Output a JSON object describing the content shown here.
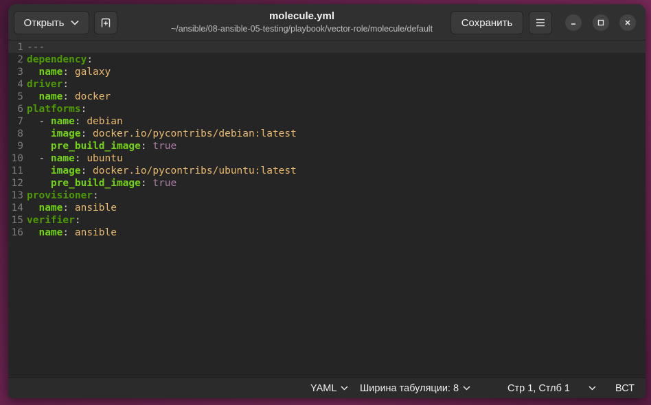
{
  "header": {
    "open_label": "Открыть",
    "save_label": "Сохранить",
    "title": "molecule.yml",
    "subtitle": "~/ansible/08-ansible-05-testing/playbook/vector-role/molecule/default"
  },
  "editor": {
    "lines": [
      {
        "n": "1",
        "parts": [
          {
            "t": "---",
            "c": "dash"
          }
        ]
      },
      {
        "n": "2",
        "parts": [
          {
            "t": "dependency",
            "c": "key"
          },
          {
            "t": ":",
            "c": "p"
          }
        ]
      },
      {
        "n": "3",
        "parts": [
          {
            "t": "  ",
            "c": "p"
          },
          {
            "t": "name",
            "c": "subkey"
          },
          {
            "t": ": ",
            "c": "p"
          },
          {
            "t": "galaxy",
            "c": "v"
          }
        ]
      },
      {
        "n": "4",
        "parts": [
          {
            "t": "driver",
            "c": "key"
          },
          {
            "t": ":",
            "c": "p"
          }
        ]
      },
      {
        "n": "5",
        "parts": [
          {
            "t": "  ",
            "c": "p"
          },
          {
            "t": "name",
            "c": "subkey"
          },
          {
            "t": ": ",
            "c": "p"
          },
          {
            "t": "docker",
            "c": "v"
          }
        ]
      },
      {
        "n": "6",
        "parts": [
          {
            "t": "platforms",
            "c": "key"
          },
          {
            "t": ":",
            "c": "p"
          }
        ]
      },
      {
        "n": "7",
        "parts": [
          {
            "t": "  - ",
            "c": "p"
          },
          {
            "t": "name",
            "c": "subkey"
          },
          {
            "t": ": ",
            "c": "p"
          },
          {
            "t": "debian",
            "c": "v"
          }
        ]
      },
      {
        "n": "8",
        "parts": [
          {
            "t": "    ",
            "c": "p"
          },
          {
            "t": "image",
            "c": "subkey"
          },
          {
            "t": ": ",
            "c": "p"
          },
          {
            "t": "docker.io/pycontribs/debian:latest",
            "c": "v"
          }
        ]
      },
      {
        "n": "9",
        "parts": [
          {
            "t": "    ",
            "c": "p"
          },
          {
            "t": "pre_build_image",
            "c": "subkey"
          },
          {
            "t": ": ",
            "c": "p"
          },
          {
            "t": "true",
            "c": "b"
          }
        ]
      },
      {
        "n": "10",
        "parts": [
          {
            "t": "  - ",
            "c": "p"
          },
          {
            "t": "name",
            "c": "subkey"
          },
          {
            "t": ": ",
            "c": "p"
          },
          {
            "t": "ubuntu",
            "c": "v"
          }
        ]
      },
      {
        "n": "11",
        "parts": [
          {
            "t": "    ",
            "c": "p"
          },
          {
            "t": "image",
            "c": "subkey"
          },
          {
            "t": ": ",
            "c": "p"
          },
          {
            "t": "docker.io/pycontribs/ubuntu:latest",
            "c": "v"
          }
        ]
      },
      {
        "n": "12",
        "parts": [
          {
            "t": "    ",
            "c": "p"
          },
          {
            "t": "pre_build_image",
            "c": "subkey"
          },
          {
            "t": ": ",
            "c": "p"
          },
          {
            "t": "true",
            "c": "b"
          }
        ]
      },
      {
        "n": "13",
        "parts": [
          {
            "t": "provisioner",
            "c": "key"
          },
          {
            "t": ":",
            "c": "p"
          }
        ]
      },
      {
        "n": "14",
        "parts": [
          {
            "t": "  ",
            "c": "p"
          },
          {
            "t": "name",
            "c": "subkey"
          },
          {
            "t": ": ",
            "c": "p"
          },
          {
            "t": "ansible",
            "c": "v"
          }
        ]
      },
      {
        "n": "15",
        "parts": [
          {
            "t": "verifier",
            "c": "key"
          },
          {
            "t": ":",
            "c": "p"
          }
        ]
      },
      {
        "n": "16",
        "parts": [
          {
            "t": "  ",
            "c": "p"
          },
          {
            "t": "name",
            "c": "subkey"
          },
          {
            "t": ": ",
            "c": "p"
          },
          {
            "t": "ansible",
            "c": "v"
          }
        ]
      }
    ]
  },
  "status": {
    "language": "YAML",
    "tab_width": "Ширина табуляции: 8",
    "position": "Стр 1, Стлб 1",
    "insert_mode": "ВСТ"
  },
  "icons": {
    "open_chevron": "chevron-down-icon",
    "new_tab": "new-tab-icon",
    "menu": "hamburger-menu-icon",
    "minimize": "minimize-icon",
    "maximize": "maximize-icon",
    "close": "close-icon"
  },
  "colors": {
    "yaml_key": "#4e9a06",
    "yaml_subkey": "#73d216",
    "yaml_value": "#e9b96e",
    "yaml_bool": "#ad7fa8"
  }
}
